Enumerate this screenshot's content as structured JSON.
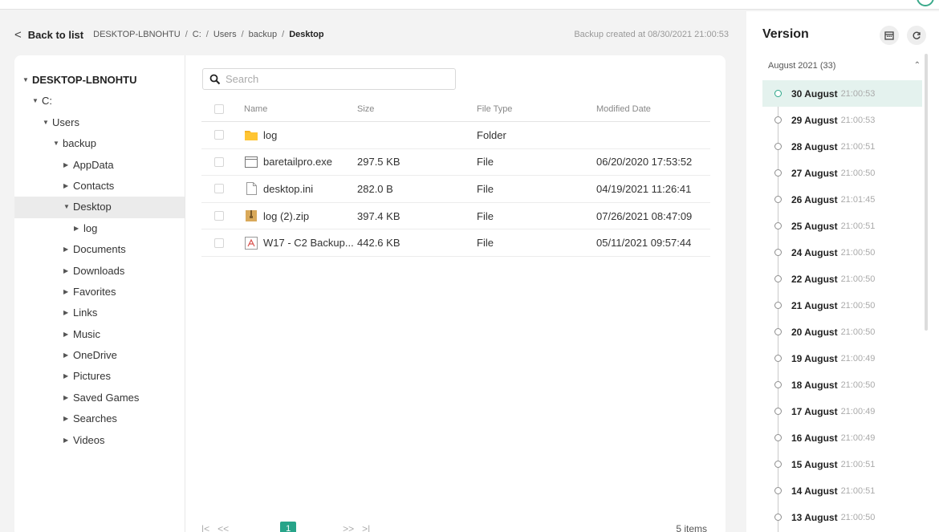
{
  "breadcrumb": {
    "back_label": "Back to list",
    "path": [
      "DESKTOP-LBNOHTU",
      "C:",
      "Users",
      "backup",
      "Desktop"
    ],
    "backup_info": "Backup created at 08/30/2021 21:00:53"
  },
  "tree": {
    "items": [
      {
        "label": "DESKTOP-LBNOHTU",
        "expanded": true
      },
      {
        "label": "C:",
        "expanded": true
      },
      {
        "label": "Users",
        "expanded": true
      },
      {
        "label": "backup",
        "expanded": true
      },
      {
        "label": "AppData",
        "expanded": false
      },
      {
        "label": "Contacts",
        "expanded": false
      },
      {
        "label": "Desktop",
        "expanded": true,
        "selected": true
      },
      {
        "label": "log",
        "expanded": false
      },
      {
        "label": "Documents",
        "expanded": false
      },
      {
        "label": "Downloads",
        "expanded": false
      },
      {
        "label": "Favorites",
        "expanded": false
      },
      {
        "label": "Links",
        "expanded": false
      },
      {
        "label": "Music",
        "expanded": false
      },
      {
        "label": "OneDrive",
        "expanded": false
      },
      {
        "label": "Pictures",
        "expanded": false
      },
      {
        "label": "Saved Games",
        "expanded": false
      },
      {
        "label": "Searches",
        "expanded": false
      },
      {
        "label": "Videos",
        "expanded": false
      }
    ]
  },
  "search": {
    "placeholder": "Search",
    "value": ""
  },
  "table": {
    "headers": {
      "name": "Name",
      "size": "Size",
      "type": "File Type",
      "date": "Modified Date"
    },
    "rows": [
      {
        "name": "log",
        "size": "",
        "type": "Folder",
        "date": "",
        "icon": "folder-icon"
      },
      {
        "name": "baretailpro.exe",
        "size": "297.5 KB",
        "type": "File",
        "date": "06/20/2020 17:53:52",
        "icon": "executable-icon"
      },
      {
        "name": "desktop.ini",
        "size": "282.0 B",
        "type": "File",
        "date": "04/19/2021 11:26:41",
        "icon": "document-icon"
      },
      {
        "name": "log (2).zip",
        "size": "397.4 KB",
        "type": "File",
        "date": "07/26/2021 08:47:09",
        "icon": "zip-icon"
      },
      {
        "name": "W17 - C2 Backup...",
        "size": "442.6 KB",
        "type": "File",
        "date": "05/11/2021 09:57:44",
        "icon": "pdf-icon"
      }
    ]
  },
  "pager": {
    "first": "|<",
    "prev": "<<",
    "page": "1",
    "next": ">>",
    "last": ">|",
    "count": "5 items"
  },
  "version": {
    "title": "Version",
    "month": "August 2021 (33)",
    "items": [
      {
        "date": "30 August",
        "time": "21:00:53",
        "active": true
      },
      {
        "date": "29 August",
        "time": "21:00:53"
      },
      {
        "date": "28 August",
        "time": "21:00:51"
      },
      {
        "date": "27 August",
        "time": "21:00:50"
      },
      {
        "date": "26 August",
        "time": "21:01:45"
      },
      {
        "date": "25 August",
        "time": "21:00:51"
      },
      {
        "date": "24 August",
        "time": "21:00:50"
      },
      {
        "date": "22 August",
        "time": "21:00:50"
      },
      {
        "date": "21 August",
        "time": "21:00:50"
      },
      {
        "date": "20 August",
        "time": "21:00:50"
      },
      {
        "date": "19 August",
        "time": "21:00:49"
      },
      {
        "date": "18 August",
        "time": "21:00:50"
      },
      {
        "date": "17 August",
        "time": "21:00:49"
      },
      {
        "date": "16 August",
        "time": "21:00:49"
      },
      {
        "date": "15 August",
        "time": "21:00:51"
      },
      {
        "date": "14 August",
        "time": "21:00:51"
      },
      {
        "date": "13 August",
        "time": "21:00:50"
      }
    ]
  },
  "colors": {
    "accent": "#27a489",
    "selected_row": "#ebebeb",
    "active_version": "#e4f2ee"
  }
}
